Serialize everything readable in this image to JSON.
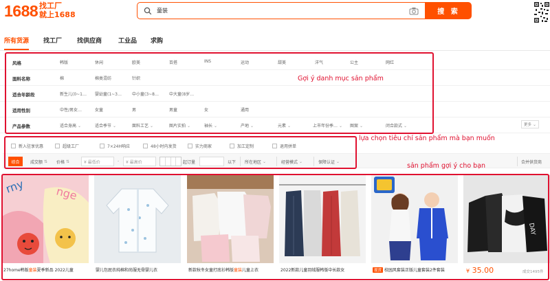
{
  "header": {
    "logo": "1688",
    "slogan_line1": "找工厂",
    "slogan_line2": "就上1688",
    "search_value": "童装",
    "search_button": "搜 索",
    "brand_color": "#ff5000"
  },
  "tabs": [
    "所有货源",
    "找工厂",
    "找供应商",
    "工业品",
    "求购"
  ],
  "filters": [
    {
      "label": "风格",
      "options": [
        "韩版",
        "休闲",
        "欧美",
        "百搭",
        "INS",
        "运动",
        "甜美",
        "洋气",
        "公主",
        "网红"
      ]
    },
    {
      "label": "面料名称",
      "options": [
        "棉",
        "棉类混纺",
        "针织"
      ]
    },
    {
      "label": "适合年龄段",
      "options": [
        "新生儿(0~1…",
        "婴幼童(1~3…",
        "中小童(3~8…",
        "中大童(8岁…"
      ]
    },
    {
      "label": "适用性别",
      "options": [
        "中性/男女…",
        "女童",
        "男",
        "男童",
        "女",
        "通用"
      ]
    },
    {
      "label": "产品参数",
      "options": [
        "适合身高",
        "适合季节",
        "面料工艺",
        "图片实拍",
        "袖长",
        "产地",
        "元素",
        "上市年份季…",
        "图案",
        "闭合款式"
      ]
    }
  ],
  "more_label": "更多",
  "checks": [
    "新入驻享优惠",
    "超级工厂",
    "7×24H响应",
    "48小时内发货",
    "实力商家",
    "加工定制",
    "退用拼单"
  ],
  "sort": {
    "default": "综合",
    "sales": "成交额",
    "price": "价格",
    "min_price": "¥ 最低价",
    "dash": "-",
    "max_price": "¥ 最高价",
    "moq_label": "起订量",
    "moq_suffix": "以下",
    "location": "所在地区",
    "model": "经营模式",
    "cert": "保障认证",
    "group": "合并供货商"
  },
  "products": [
    {
      "title_pre": "27home韩版",
      "title_hl": "童装",
      "title_post": "夏季新品 2022儿童"
    },
    {
      "title_pre": "婴儿包屁衣纯棉和尚服无骨婴儿衣",
      "title_hl": "",
      "title_post": ""
    },
    {
      "title_pre": "新款秋冬女童打底衫韩版",
      "title_hl": "童装",
      "title_post": "儿童上衣"
    },
    {
      "title_pre": "2022新款儿童羽绒服韩版中长款女",
      "title_hl": "",
      "title_post": ""
    },
    {
      "title_pre": "",
      "title_hl": "",
      "title_post": "校园风套装正版儿童套装2件套装"
    },
    {
      "title_pre": "",
      "title_hl": "",
      "title_post": ""
    }
  ],
  "hot_tag": "现货",
  "price": "35.00",
  "price_symbol": "¥",
  "sales": "成交1495件",
  "annotations": {
    "category": "Gợi ý danh mục sản phẩm",
    "filters": "lựa chọn tiêu chí sản phẩm mà bạn muốn",
    "products": "sản phẩm gợi ý cho bạn",
    "color": "#e0102f"
  }
}
